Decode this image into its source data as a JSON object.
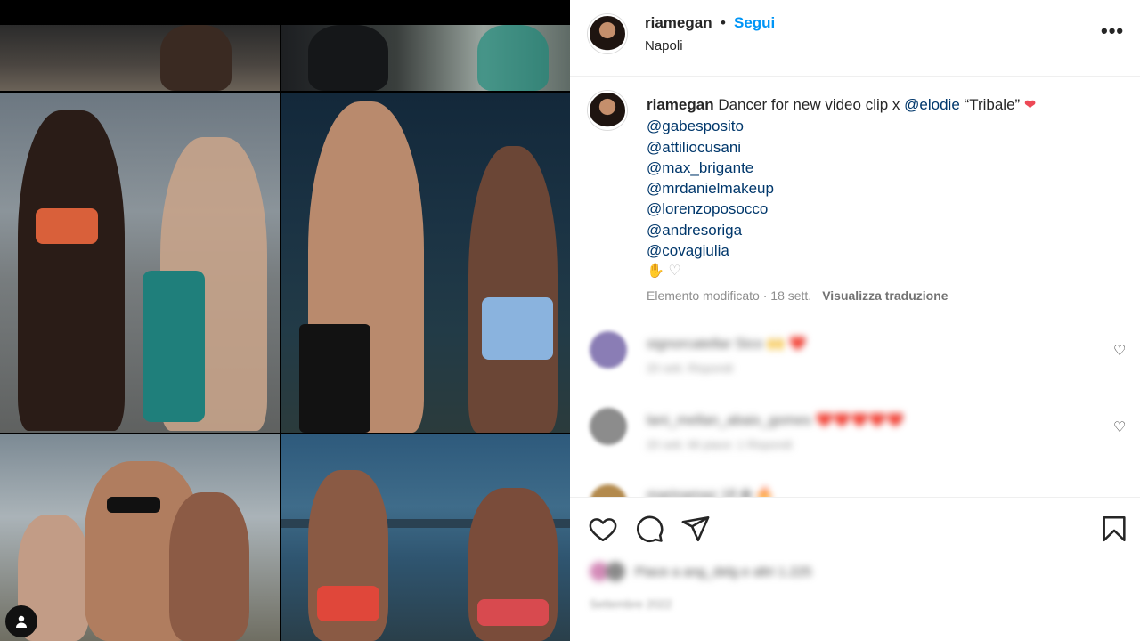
{
  "post": {
    "username": "riamegan",
    "separator": "•",
    "follow_label": "Segui",
    "location": "Napoli",
    "more_icon": "more-horizontal-icon"
  },
  "caption": {
    "username": "riamegan",
    "text": "Dancer for new video clip x",
    "mention_inline": "@elodie",
    "title": "“Tribale”",
    "mentions": [
      "@gabesposito",
      "@attiliocusani",
      "@max_brigante",
      "@mrdanielmakeup",
      "@lorenzoposocco",
      "@andresoriga",
      "@covagiulia"
    ],
    "edited": "Elemento modificato · 18 sett.",
    "translate_label": "Visualizza traduzione"
  },
  "comments": [
    {
      "text": "signorcatellar Sico 🙌 ❤️",
      "sub": "20 sett.   Rispondi"
    },
    {
      "text": "lani_mellan_abaix_gomes ❤️❤️❤️❤️❤️",
      "sub": "20 sett.   Mi piace: 1   Rispondi"
    },
    {
      "text": "marinamaz 1fl ✿ 🔥",
      "sub": ""
    }
  ],
  "actions": {
    "like_icon": "heart-outline-icon",
    "comment_icon": "comment-icon",
    "share_icon": "paper-plane-icon",
    "save_icon": "bookmark-icon",
    "likes_text": "Piace a ang_delg e altri 1.225",
    "date_text": "Settembre 2022"
  },
  "colors": {
    "accent": "#0095f6",
    "mention": "#00376b",
    "text": "#262626",
    "muted": "#8e8e8e"
  }
}
